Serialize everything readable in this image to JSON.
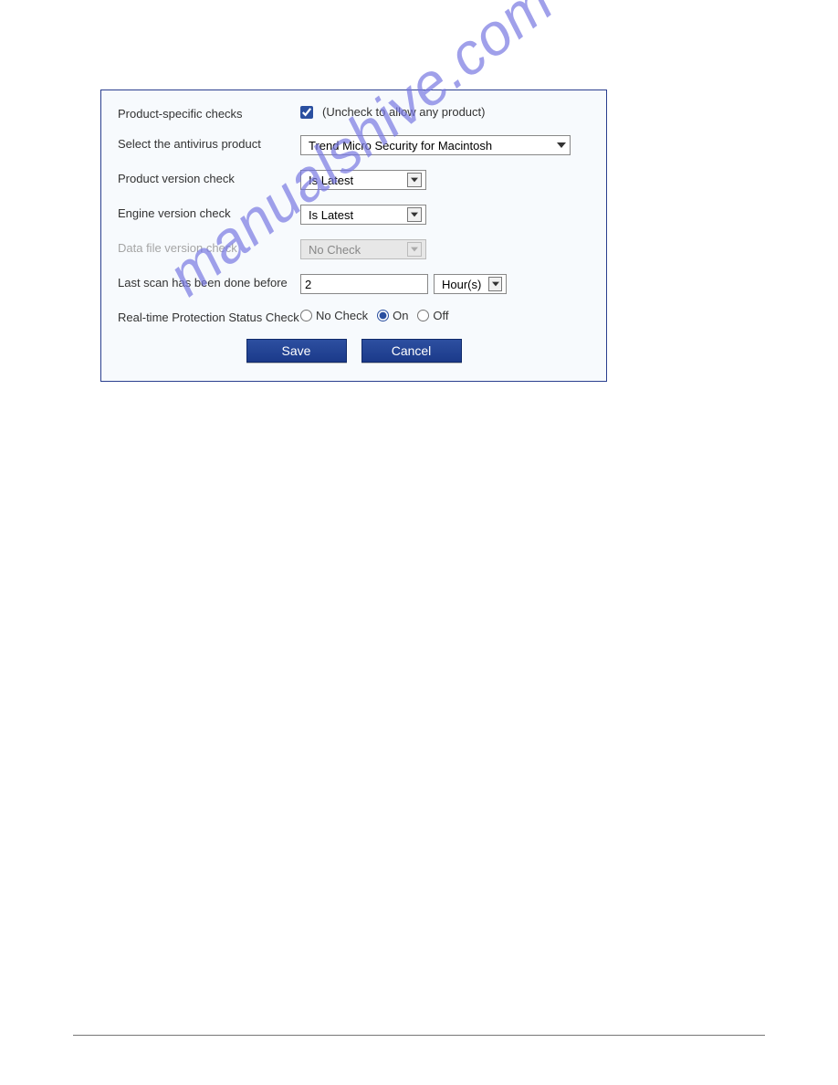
{
  "labels": {
    "product_specific": "Product-specific checks",
    "product_specific_hint": "(Uncheck to allow any product)",
    "select_product": "Select the antivirus product",
    "product_version": "Product version check",
    "engine_version": "Engine version check",
    "data_file_version": "Data file version check",
    "last_scan": "Last scan has been done before",
    "realtime": "Real-time Protection Status Check"
  },
  "values": {
    "product_specific_checked": true,
    "antivirus_product": "Trend Micro Security for Macintosh",
    "product_version_check": "Is Latest",
    "engine_version_check": "Is Latest",
    "data_file_version_check": "No Check",
    "last_scan_value": "2",
    "last_scan_unit": "Hour(s)",
    "realtime_selected": "On"
  },
  "radio": {
    "no_check": "No Check",
    "on": "On",
    "off": "Off"
  },
  "buttons": {
    "save": "Save",
    "cancel": "Cancel"
  },
  "watermark": "manualshive.com"
}
